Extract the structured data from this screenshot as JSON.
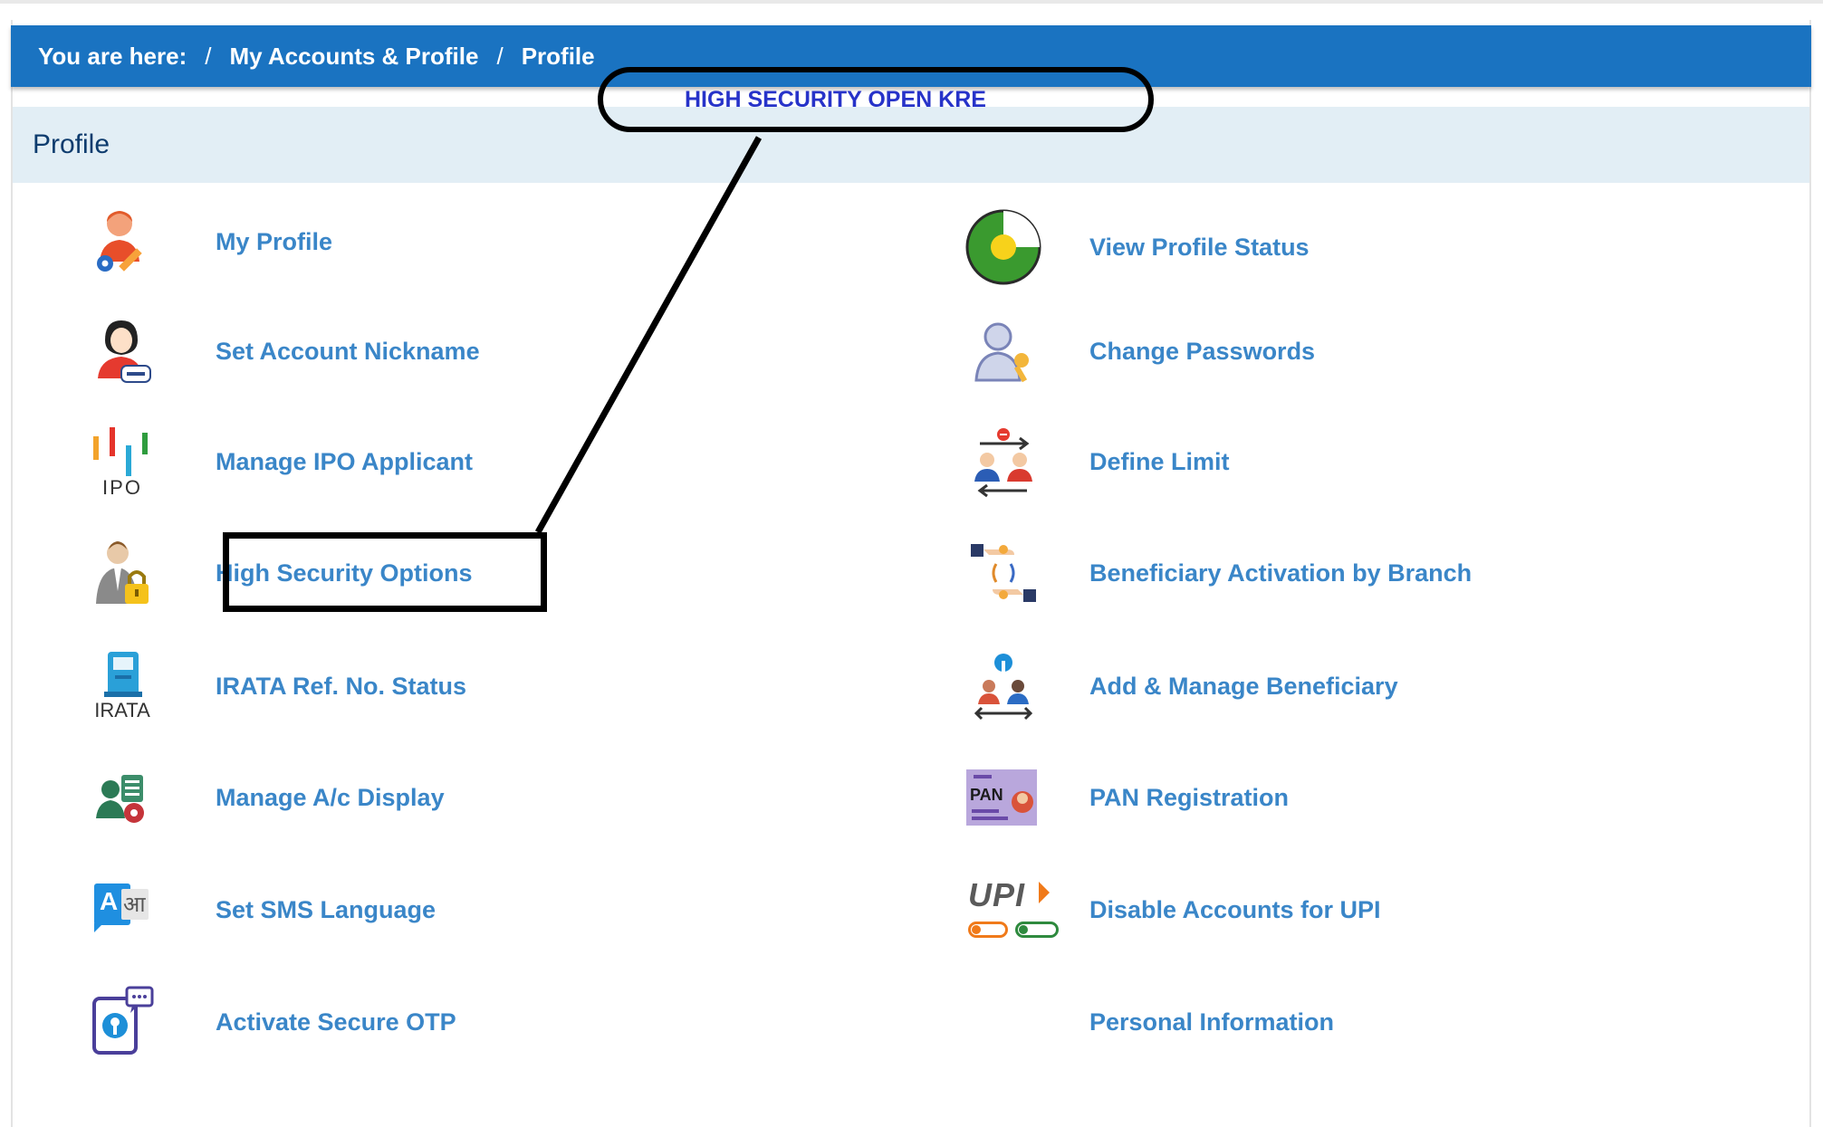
{
  "breadcrumb": {
    "prefix": "You are here:",
    "separator": "/",
    "items": [
      "My Accounts & Profile",
      "Profile"
    ]
  },
  "section": {
    "title": "Profile"
  },
  "annotation": {
    "callout_text": "HIGH SECURITY OPEN KRE"
  },
  "left_items": [
    {
      "label": "My Profile",
      "icon": "user-edit-icon"
    },
    {
      "label": "Set Account Nickname",
      "icon": "user-nickname-icon"
    },
    {
      "label": "Manage IPO Applicant",
      "icon": "ipo-icon",
      "icon_text": "IPO"
    },
    {
      "label": "High Security Options",
      "icon": "user-lock-icon"
    },
    {
      "label": "IRATA Ref. No. Status",
      "icon": "irata-icon",
      "icon_text": "IRATA"
    },
    {
      "label": "Manage A/c Display",
      "icon": "users-settings-icon"
    },
    {
      "label": "Set SMS Language",
      "icon": "language-icon",
      "icon_text_a": "A",
      "icon_text_b": "आ"
    },
    {
      "label": "Activate Secure OTP",
      "icon": "secure-otp-icon"
    }
  ],
  "right_items": [
    {
      "label": "View Profile Status",
      "icon": "profile-status-icon"
    },
    {
      "label": "Change Passwords",
      "icon": "user-key-icon"
    },
    {
      "label": "Define Limit",
      "icon": "define-limit-icon"
    },
    {
      "label": "Beneficiary Activation by Branch",
      "icon": "beneficiary-activation-icon"
    },
    {
      "label": "Add & Manage Beneficiary",
      "icon": "manage-beneficiary-icon"
    },
    {
      "label": "PAN Registration",
      "icon": "pan-card-icon",
      "icon_text": "PAN"
    },
    {
      "label": "Disable Accounts for UPI",
      "icon": "upi-icon",
      "icon_text": "UPI"
    },
    {
      "label": "Personal Information",
      "icon": ""
    }
  ],
  "colors": {
    "breadcrumb_bg": "#1a73c1",
    "section_bg": "#e2eef5",
    "link": "#3a86c8",
    "callout_text": "#2733c9"
  }
}
